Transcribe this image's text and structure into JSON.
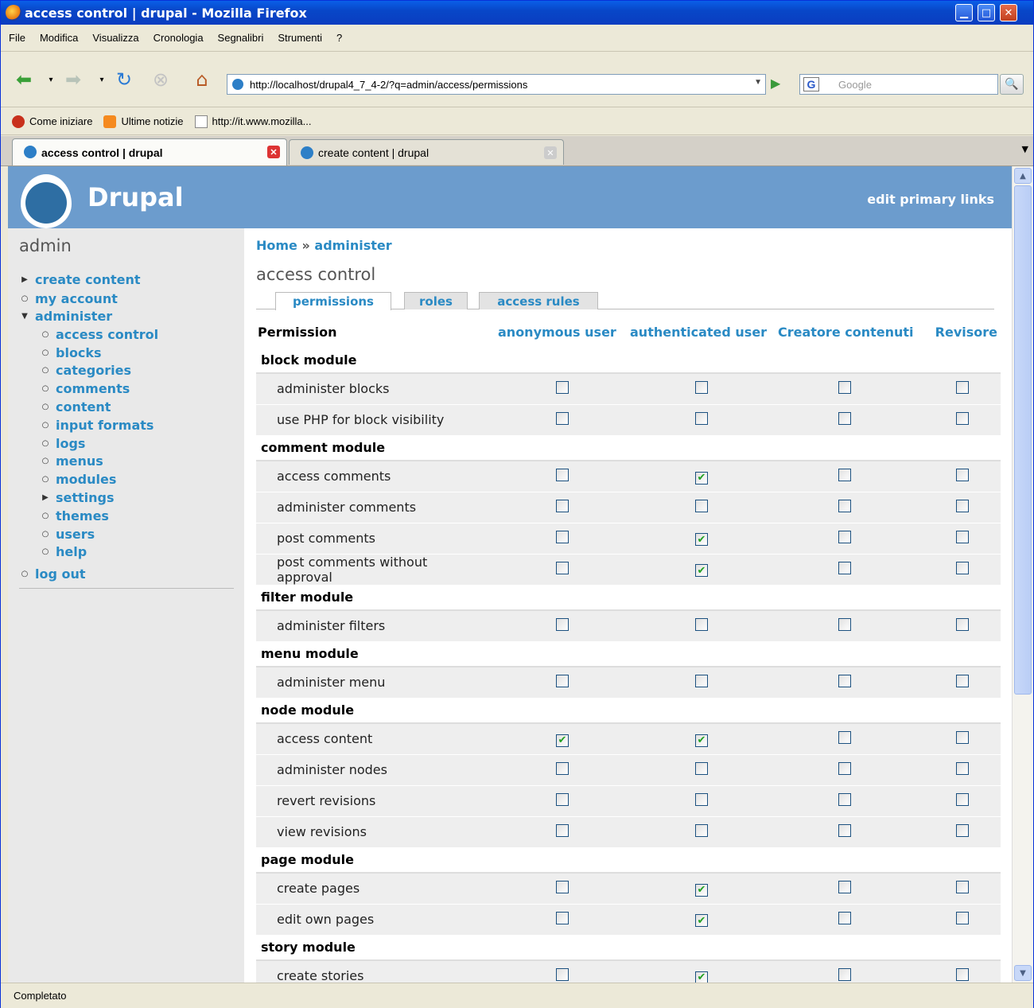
{
  "window": {
    "title": "access control | drupal - Mozilla Firefox"
  },
  "menubar": [
    "File",
    "Modifica",
    "Visualizza",
    "Cronologia",
    "Segnalibri",
    "Strumenti",
    "?"
  ],
  "nav": {
    "url": "http://localhost/drupal4_7_4-2/?q=admin/access/permissions",
    "search_placeholder": "Google"
  },
  "bookmarks": [
    "Come iniziare",
    "Ultime notizie",
    "http://it.www.mozilla..."
  ],
  "browser_tabs": [
    {
      "label": "access control | drupal",
      "active": true
    },
    {
      "label": "create content | drupal",
      "active": false
    }
  ],
  "site": {
    "name": "Drupal",
    "primary_link": "edit primary links"
  },
  "sidebar": {
    "title": "admin",
    "items": [
      {
        "label": "create content",
        "bullet": "arrow-right",
        "level": 0
      },
      {
        "label": "my account",
        "bullet": "circle",
        "level": 0
      },
      {
        "label": "administer",
        "bullet": "arrow-down",
        "level": 0
      },
      {
        "label": "access control",
        "bullet": "circle",
        "level": 1
      },
      {
        "label": "blocks",
        "bullet": "circle",
        "level": 1
      },
      {
        "label": "categories",
        "bullet": "circle",
        "level": 1
      },
      {
        "label": "comments",
        "bullet": "circle",
        "level": 1
      },
      {
        "label": "content",
        "bullet": "circle",
        "level": 1
      },
      {
        "label": "input formats",
        "bullet": "circle",
        "level": 1
      },
      {
        "label": "logs",
        "bullet": "circle",
        "level": 1
      },
      {
        "label": "menus",
        "bullet": "circle",
        "level": 1
      },
      {
        "label": "modules",
        "bullet": "circle",
        "level": 1
      },
      {
        "label": "settings",
        "bullet": "arrow-right",
        "level": 1
      },
      {
        "label": "themes",
        "bullet": "circle",
        "level": 1
      },
      {
        "label": "users",
        "bullet": "circle",
        "level": 1
      },
      {
        "label": "help",
        "bullet": "circle",
        "level": 1
      },
      {
        "label": "log out",
        "bullet": "circle",
        "level": 0
      }
    ]
  },
  "breadcrumb": {
    "home": "Home",
    "sep": "»",
    "current": "administer"
  },
  "page_title": "access control",
  "local_tabs": [
    "permissions",
    "roles",
    "access rules"
  ],
  "table": {
    "header": {
      "permission": "Permission",
      "roles": [
        "anonymous user",
        "authenticated user",
        "Creatore contenuti",
        "Revisore"
      ]
    },
    "groups": [
      {
        "module": "block module",
        "perms": [
          {
            "name": "administer blocks",
            "checks": [
              false,
              false,
              false,
              false
            ]
          },
          {
            "name": "use PHP for block visibility",
            "checks": [
              false,
              false,
              false,
              false
            ]
          }
        ]
      },
      {
        "module": "comment module",
        "perms": [
          {
            "name": "access comments",
            "checks": [
              false,
              true,
              false,
              false
            ]
          },
          {
            "name": "administer comments",
            "checks": [
              false,
              false,
              false,
              false
            ]
          },
          {
            "name": "post comments",
            "checks": [
              false,
              true,
              false,
              false
            ]
          },
          {
            "name": "post comments without approval",
            "checks": [
              false,
              true,
              false,
              false
            ]
          }
        ]
      },
      {
        "module": "filter module",
        "perms": [
          {
            "name": "administer filters",
            "checks": [
              false,
              false,
              false,
              false
            ]
          }
        ]
      },
      {
        "module": "menu module",
        "perms": [
          {
            "name": "administer menu",
            "checks": [
              false,
              false,
              false,
              false
            ]
          }
        ]
      },
      {
        "module": "node module",
        "perms": [
          {
            "name": "access content",
            "checks": [
              true,
              true,
              false,
              false
            ]
          },
          {
            "name": "administer nodes",
            "checks": [
              false,
              false,
              false,
              false
            ]
          },
          {
            "name": "revert revisions",
            "checks": [
              false,
              false,
              false,
              false
            ]
          },
          {
            "name": "view revisions",
            "checks": [
              false,
              false,
              false,
              false
            ]
          }
        ]
      },
      {
        "module": "page module",
        "perms": [
          {
            "name": "create pages",
            "checks": [
              false,
              true,
              false,
              false
            ]
          },
          {
            "name": "edit own pages",
            "checks": [
              false,
              true,
              false,
              false
            ]
          }
        ]
      },
      {
        "module": "story module",
        "perms": [
          {
            "name": "create stories",
            "checks": [
              false,
              true,
              false,
              false
            ]
          }
        ]
      }
    ]
  },
  "status": "Completato"
}
